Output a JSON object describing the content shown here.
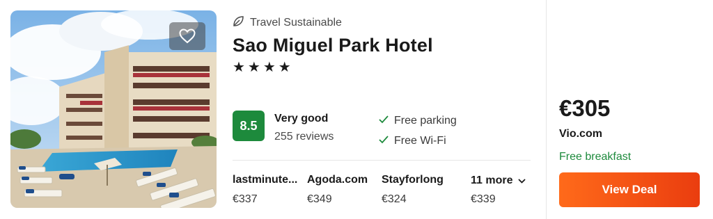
{
  "hotel": {
    "sustainability_label": "Travel Sustainable",
    "name": "Sao Miguel Park Hotel",
    "stars": "★★★★",
    "rating": {
      "score": "8.5",
      "label": "Very good",
      "reviews": "255 reviews",
      "badge_color": "#1d8a3c"
    },
    "amenities": [
      {
        "label": "Free parking",
        "icon": "check-icon"
      },
      {
        "label": "Free Wi-Fi",
        "icon": "check-icon"
      }
    ]
  },
  "providers": [
    {
      "name": "lastminute...",
      "price": "€337"
    },
    {
      "name": "Agoda.com",
      "price": "€349"
    },
    {
      "name": "Stayforlong",
      "price": "€324"
    }
  ],
  "more_deals": {
    "label": "11 more",
    "price": "€339",
    "icon": "chevron-down-icon"
  },
  "best_deal": {
    "price": "€305",
    "site": "Vio.com",
    "perk": "Free breakfast",
    "button_label": "View Deal",
    "accent_color": "#ff5a1f"
  },
  "icons": {
    "favorite": "heart-icon",
    "sustainable": "leaf-icon"
  }
}
